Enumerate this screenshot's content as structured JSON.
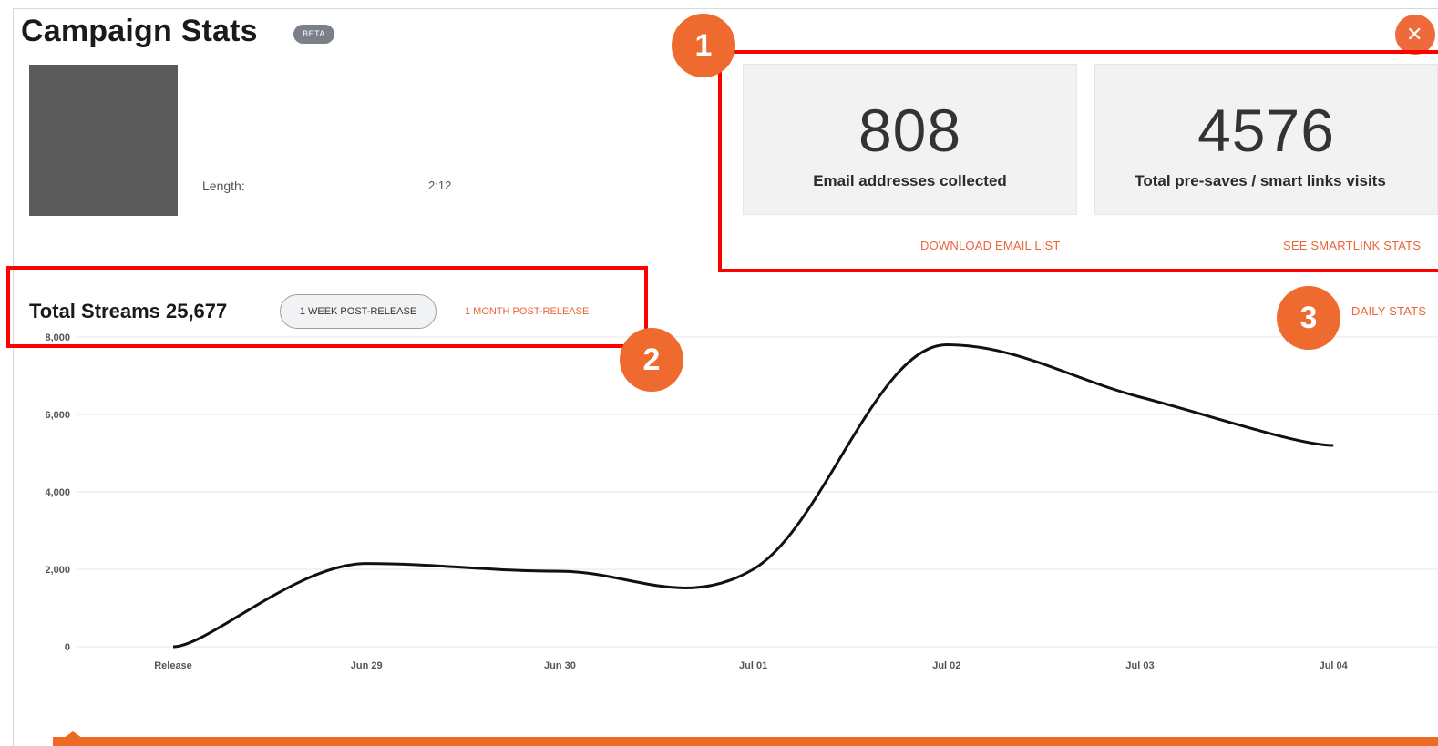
{
  "header": {
    "title": "Campaign Stats",
    "badge": "BETA",
    "close_icon": "close-icon"
  },
  "release": {
    "length_label": "Length:",
    "length_value": "2:12"
  },
  "stats": {
    "emails": {
      "value": "808",
      "label": "Email addresses collected"
    },
    "presaves": {
      "value": "4576",
      "label": "Total pre-saves / smart links visits"
    },
    "download_link": "DOWNLOAD EMAIL LIST",
    "smartlink_link": "SEE SMARTLINK STATS"
  },
  "streams": {
    "title": "Total Streams 25,677",
    "range_active": "1 WEEK POST-RELEASE",
    "range_other": "1 MONTH POST-RELEASE",
    "daily_link": "DAILY STATS"
  },
  "annotations": {
    "markers": [
      "1",
      "2",
      "3"
    ],
    "highlight_color": "#ff0000",
    "marker_color": "#ee6a2f"
  },
  "accent_color": "#e8663a",
  "chart_data": {
    "type": "line",
    "categories": [
      "Release",
      "Jun 29",
      "Jun 30",
      "Jul 01",
      "Jul 02",
      "Jul 03",
      "Jul 04"
    ],
    "values": [
      0,
      2150,
      1950,
      2000,
      7800,
      6450,
      5200
    ],
    "ylim": [
      0,
      8000
    ],
    "yticks": [
      0,
      2000,
      4000,
      6000,
      8000
    ],
    "ytick_labels": [
      "0",
      "2,000",
      "4,000",
      "6,000",
      "8,000"
    ],
    "grid": true,
    "line_color": "#111111"
  }
}
